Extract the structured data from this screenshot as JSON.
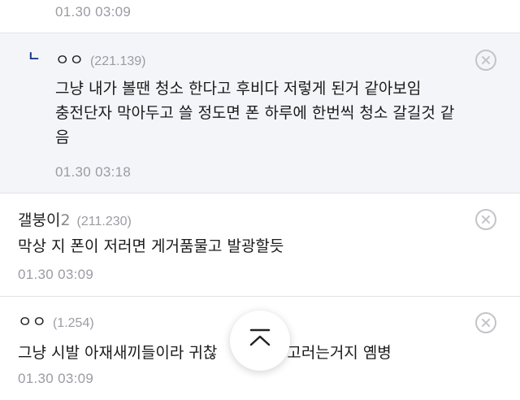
{
  "comments": [
    {
      "date": "01.30 03:09"
    },
    {
      "reply_mark": "ㄴ",
      "nickname": "ㅇㅇ",
      "ip": "(221.139)",
      "lines": [
        "그냥 내가 볼땐 청소 한다고 후비다 저렇게 된거 같아보임",
        "충전단자 막아두고 쓸 정도면 폰 하루에 한번씩 청소 갈길것 같",
        "음"
      ],
      "date": "01.30 03:18"
    },
    {
      "nickname": "갤붕이",
      "nickname_suffix": "2",
      "ip": "(211.230)",
      "lines": [
        "막상 지 폰이 저러면 게거품물고 발광할듯"
      ],
      "date": "01.30 03:09"
    },
    {
      "nickname": "ㅇㅇ",
      "ip": "(1.254)",
      "lines": [
        "그냥 시발 아재새끼들이라 귀찮",
        "고러는거지 옘병"
      ],
      "date": "01.30 03:09"
    }
  ],
  "icons": {
    "delete": "close-circle-icon",
    "scroll_top": "chevron-up-icon"
  },
  "colors": {
    "reply_bg": "#f4f5f9",
    "reply_mark": "#1e3a8a",
    "meta_gray": "#9a9ca2",
    "divider": "#e1e3e8"
  }
}
